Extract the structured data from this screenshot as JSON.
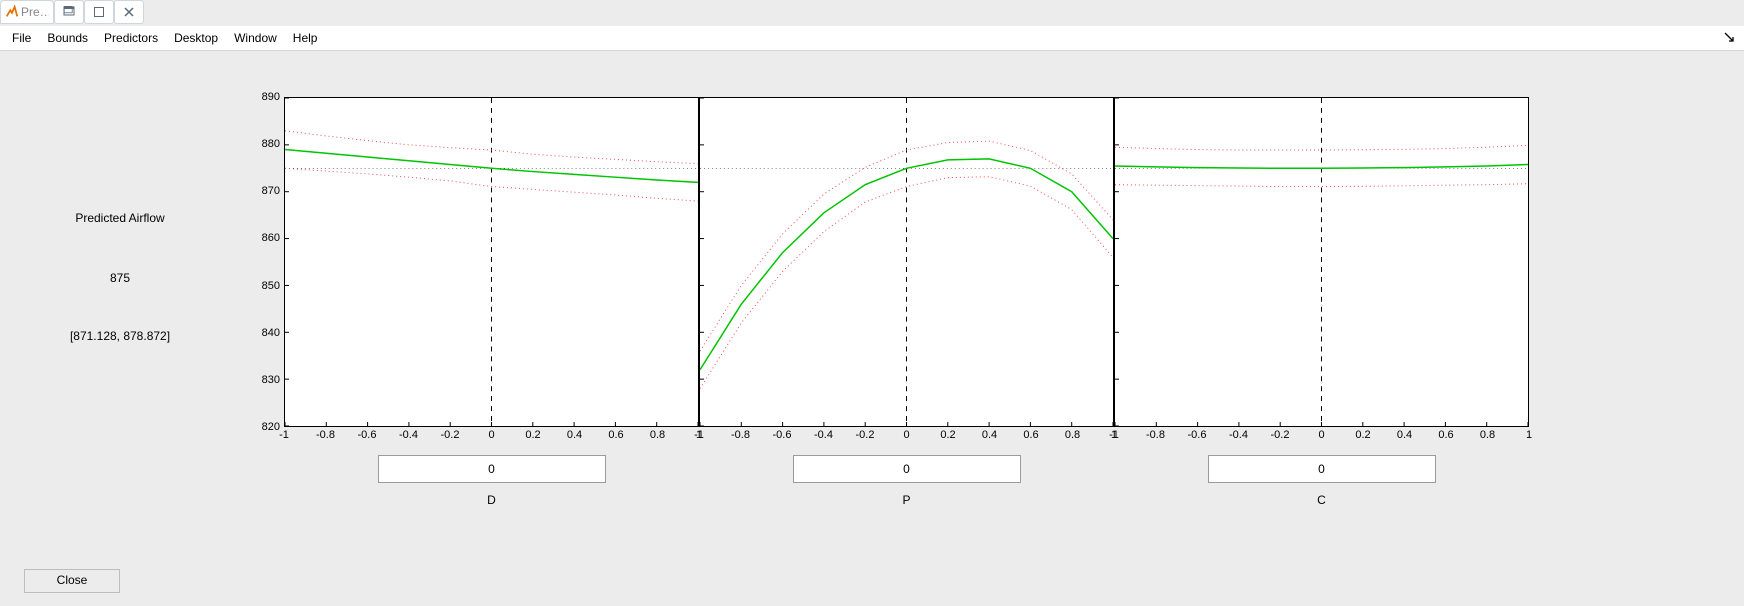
{
  "window": {
    "title": "Pre…"
  },
  "menu": {
    "items": [
      "File",
      "Bounds",
      "Predictors",
      "Desktop",
      "Window",
      "Help"
    ]
  },
  "left": {
    "label": "Predicted Airflow",
    "value": "875",
    "ci": "[871.128, 878.872]"
  },
  "buttons": {
    "close": "Close"
  },
  "axes": {
    "y_ticks": [
      820,
      830,
      840,
      850,
      860,
      870,
      880,
      890
    ],
    "x_ticks": [
      -1,
      -0.8,
      -0.6,
      -0.4,
      -0.2,
      0,
      0.2,
      0.4,
      0.6,
      0.8,
      1
    ],
    "ylim": [
      820,
      890
    ],
    "xlim": [
      -1,
      1
    ],
    "reference_y": 875
  },
  "panels": [
    {
      "name": "D",
      "value": "0"
    },
    {
      "name": "P",
      "value": "0"
    },
    {
      "name": "C",
      "value": "0"
    }
  ],
  "chart_data": [
    {
      "type": "line",
      "title": "",
      "xlabel": "D",
      "ylabel": "",
      "xlim": [
        -1,
        1
      ],
      "ylim": [
        820,
        890
      ],
      "reference_y": 875,
      "series": [
        {
          "name": "fit",
          "x": [
            -1,
            -0.8,
            -0.6,
            -0.4,
            -0.2,
            0,
            0.2,
            0.4,
            0.6,
            0.8,
            1
          ],
          "values": [
            879.0,
            878.2,
            877.4,
            876.6,
            875.8,
            875.0,
            874.3,
            873.7,
            873.1,
            872.5,
            872.0
          ]
        },
        {
          "name": "upper",
          "x": [
            -1,
            -0.8,
            -0.6,
            -0.4,
            -0.2,
            0,
            0.2,
            0.4,
            0.6,
            0.8,
            1
          ],
          "values": [
            883.0,
            881.9,
            880.9,
            880.0,
            879.4,
            878.9,
            878.0,
            877.4,
            876.9,
            876.4,
            876.0
          ]
        },
        {
          "name": "lower",
          "x": [
            -1,
            -0.8,
            -0.6,
            -0.4,
            -0.2,
            0,
            0.2,
            0.4,
            0.6,
            0.8,
            1
          ],
          "values": [
            875.0,
            874.4,
            873.8,
            873.1,
            872.3,
            871.1,
            870.5,
            869.9,
            869.3,
            868.6,
            868.0
          ]
        }
      ]
    },
    {
      "type": "line",
      "title": "",
      "xlabel": "P",
      "ylabel": "",
      "xlim": [
        -1,
        1
      ],
      "ylim": [
        820,
        890
      ],
      "reference_y": 875,
      "series": [
        {
          "name": "fit",
          "x": [
            -1,
            -0.8,
            -0.6,
            -0.4,
            -0.2,
            0,
            0.2,
            0.4,
            0.6,
            0.8,
            1
          ],
          "values": [
            832.0,
            846.0,
            857.0,
            865.5,
            871.5,
            875.0,
            876.8,
            877.0,
            875.0,
            870.0,
            860.0
          ]
        },
        {
          "name": "upper",
          "x": [
            -1,
            -0.8,
            -0.6,
            -0.4,
            -0.2,
            0,
            0.2,
            0.4,
            0.6,
            0.8,
            1
          ],
          "values": [
            836.0,
            850.0,
            861.0,
            869.5,
            875.2,
            878.9,
            880.5,
            880.8,
            878.8,
            873.8,
            864.0
          ]
        },
        {
          "name": "lower",
          "x": [
            -1,
            -0.8,
            -0.6,
            -0.4,
            -0.2,
            0,
            0.2,
            0.4,
            0.6,
            0.8,
            1
          ],
          "values": [
            828.0,
            842.0,
            853.0,
            861.5,
            867.8,
            871.1,
            873.0,
            873.2,
            871.2,
            866.2,
            856.0
          ]
        }
      ]
    },
    {
      "type": "line",
      "title": "",
      "xlabel": "C",
      "ylabel": "",
      "xlim": [
        -1,
        1
      ],
      "ylim": [
        820,
        890
      ],
      "reference_y": 875,
      "series": [
        {
          "name": "fit",
          "x": [
            -1,
            -0.8,
            -0.6,
            -0.4,
            -0.2,
            0,
            0.2,
            0.4,
            0.6,
            0.8,
            1
          ],
          "values": [
            875.5,
            875.3,
            875.15,
            875.05,
            875.0,
            875.0,
            875.05,
            875.15,
            875.3,
            875.5,
            875.8
          ]
        },
        {
          "name": "upper",
          "x": [
            -1,
            -0.8,
            -0.6,
            -0.4,
            -0.2,
            0,
            0.2,
            0.4,
            0.6,
            0.8,
            1
          ],
          "values": [
            879.5,
            879.2,
            879.0,
            878.9,
            878.9,
            878.9,
            878.95,
            879.05,
            879.2,
            879.5,
            879.9
          ]
        },
        {
          "name": "lower",
          "x": [
            -1,
            -0.8,
            -0.6,
            -0.4,
            -0.2,
            0,
            0.2,
            0.4,
            0.6,
            0.8,
            1
          ],
          "values": [
            871.5,
            871.4,
            871.3,
            871.2,
            871.1,
            871.1,
            871.15,
            871.25,
            871.4,
            871.5,
            871.7
          ]
        }
      ]
    }
  ]
}
